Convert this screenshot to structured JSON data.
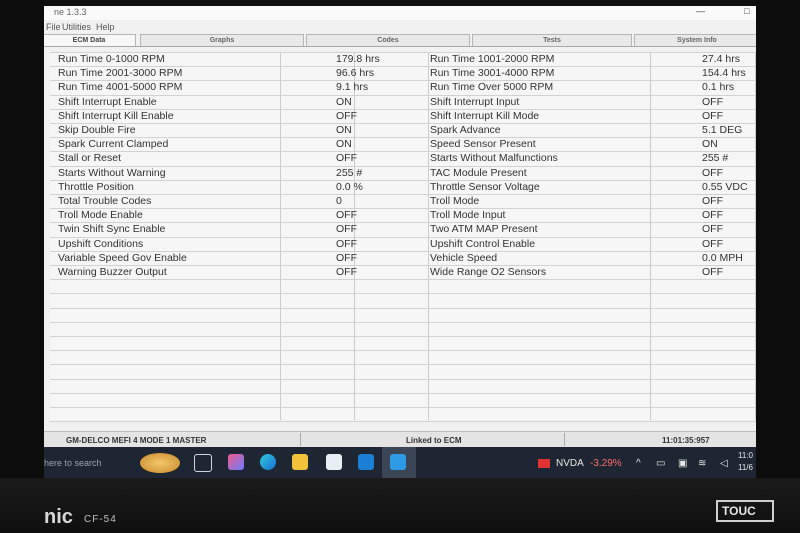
{
  "window": {
    "title": "ne 1.3.3",
    "restore_glyph": "□"
  },
  "menu": [
    "File",
    "Utilities",
    "Help"
  ],
  "tabs": [
    "ECM Data",
    "Graphs",
    "Codes",
    "Tests",
    "System Info"
  ],
  "data_rows": [
    {
      "l_name": "Run Time 0-1000 RPM",
      "l_value": "179.8 hrs",
      "r_name": "Run Time 1001-2000 RPM",
      "r_value": "27.4 hrs"
    },
    {
      "l_name": "Run Time 2001-3000 RPM",
      "l_value": "96.6 hrs",
      "r_name": "Run Time 3001-4000 RPM",
      "r_value": "154.4 hrs"
    },
    {
      "l_name": "Run Time 4001-5000 RPM",
      "l_value": "9.1 hrs",
      "r_name": "Run Time Over 5000 RPM",
      "r_value": "0.1 hrs"
    },
    {
      "l_name": "Shift Interrupt Enable",
      "l_value": "ON",
      "r_name": "Shift Interrupt Input",
      "r_value": "OFF"
    },
    {
      "l_name": "Shift Interrupt Kill Enable",
      "l_value": "OFF",
      "r_name": "Shift Interrupt Kill Mode",
      "r_value": "OFF"
    },
    {
      "l_name": "Skip Double Fire",
      "l_value": "ON",
      "r_name": "Spark Advance",
      "r_value": "5.1 DEG"
    },
    {
      "l_name": "Spark Current Clamped",
      "l_value": "ON",
      "r_name": "Speed Sensor Present",
      "r_value": "ON"
    },
    {
      "l_name": "Stall or Reset",
      "l_value": "OFF",
      "r_name": "Starts Without Malfunctions",
      "r_value": "255 #"
    },
    {
      "l_name": "Starts Without Warning",
      "l_value": "255 #",
      "r_name": "TAC Module Present",
      "r_value": "OFF"
    },
    {
      "l_name": "Throttle Position",
      "l_value": "0.0 %",
      "r_name": "Throttle Sensor Voltage",
      "r_value": "0.55 VDC"
    },
    {
      "l_name": "Total Trouble Codes",
      "l_value": "0",
      "r_name": "Troll Mode",
      "r_value": "OFF"
    },
    {
      "l_name": "Troll Mode Enable",
      "l_value": "OFF",
      "r_name": "Troll Mode Input",
      "r_value": "OFF"
    },
    {
      "l_name": "Twin Shift Sync Enable",
      "l_value": "OFF",
      "r_name": "Two ATM MAP Present",
      "r_value": "OFF"
    },
    {
      "l_name": "Upshift Conditions",
      "l_value": "OFF",
      "r_name": "Upshift Control Enable",
      "r_value": "OFF"
    },
    {
      "l_name": "Variable Speed Gov Enable",
      "l_value": "OFF",
      "r_name": "Vehicle Speed",
      "r_value": "0.0 MPH"
    },
    {
      "l_name": "Warning Buzzer Output",
      "l_value": "OFF",
      "r_name": "Wide Range O2 Sensors",
      "r_value": "OFF"
    }
  ],
  "status": {
    "device": "GM-DELCO MEFI 4 MODE 1 MASTER",
    "link": "Linked to ECM",
    "time": "11:01:35:957"
  },
  "taskbar": {
    "search_placeholder": "here to search",
    "stock_name": "NVDA",
    "stock_change": "-3.29%",
    "clock_time": "11:0",
    "clock_date": "11/6"
  },
  "bezel": {
    "brand": "nic",
    "model": "CF-54",
    "badge": "TOUC"
  },
  "colors": {
    "taskbar_bg": "#1d2632",
    "stock_negative": "#ff6b6b"
  }
}
